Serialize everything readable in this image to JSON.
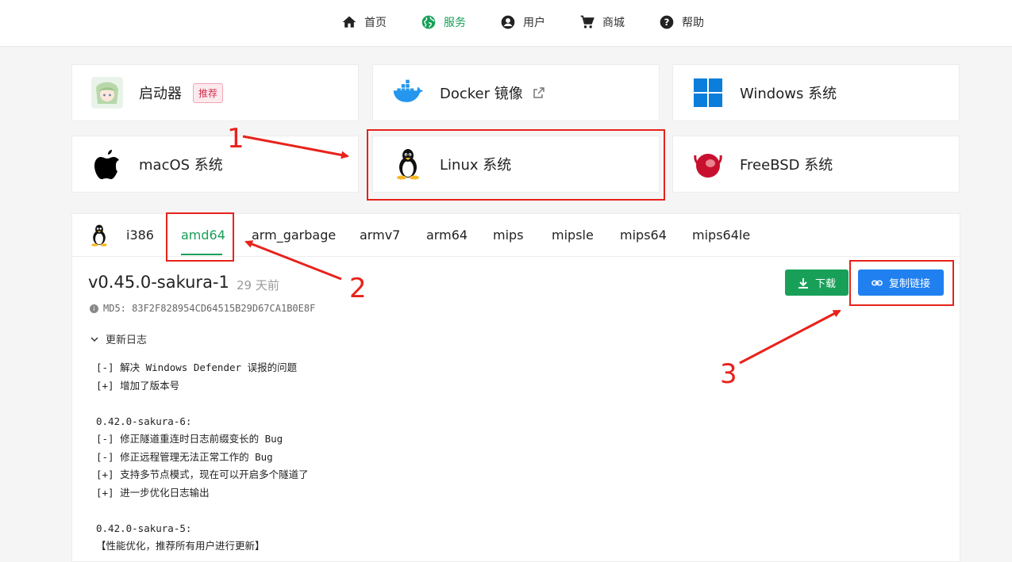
{
  "nav": {
    "items": [
      {
        "label": "首页",
        "icon": "home-icon"
      },
      {
        "label": "服务",
        "icon": "globe-icon",
        "active": true
      },
      {
        "label": "用户",
        "icon": "user-icon"
      },
      {
        "label": "商城",
        "icon": "cart-icon"
      },
      {
        "label": "帮助",
        "icon": "help-icon"
      }
    ],
    "active_color": "#18a058"
  },
  "cards": [
    {
      "label": "启动器",
      "badge": "推荐",
      "icon": "launcher-avatar-icon"
    },
    {
      "label": "Docker 镜像",
      "icon": "docker-icon",
      "external": true
    },
    {
      "label": "Windows 系统",
      "icon": "windows-icon"
    },
    {
      "label": "macOS 系统",
      "icon": "apple-icon"
    },
    {
      "label": "Linux 系统",
      "icon": "linux-tux-icon",
      "highlighted": true
    },
    {
      "label": "FreeBSD 系统",
      "icon": "freebsd-icon"
    }
  ],
  "arch_tabs": {
    "icon": "linux-tux-icon",
    "items": [
      "i386",
      "amd64",
      "arm_garbage",
      "armv7",
      "arm64",
      "mips",
      "mipsle",
      "mips64",
      "mips64le"
    ],
    "active": "amd64"
  },
  "release": {
    "version": "v0.45.0-sakura-1",
    "ago": "29 天前",
    "md5": "MD5: 83F2F828954CD64515B29D67CA1B0E8F"
  },
  "buttons": {
    "download": "下载",
    "copy_link": "复制链接",
    "download_color": "#18a058",
    "copy_color": "#2080f0"
  },
  "changelog": {
    "toggle_label": "更新日志",
    "lines": [
      "[-] 解决 Windows Defender 误报的问题",
      "[+] 增加了版本号",
      "",
      "0.42.0-sakura-6:",
      "[-] 修正隧道重连时日志前缀变长的 Bug",
      "[-] 修正远程管理无法正常工作的 Bug",
      "[+] 支持多节点模式，现在可以开启多个隧道了",
      "[+] 进一步优化日志输出",
      "",
      "0.42.0-sakura-5:",
      "【性能优化，推荐所有用户进行更新】"
    ]
  },
  "annotations": {
    "numbers": [
      "1",
      "2",
      "3"
    ],
    "color": "#e8221b"
  }
}
